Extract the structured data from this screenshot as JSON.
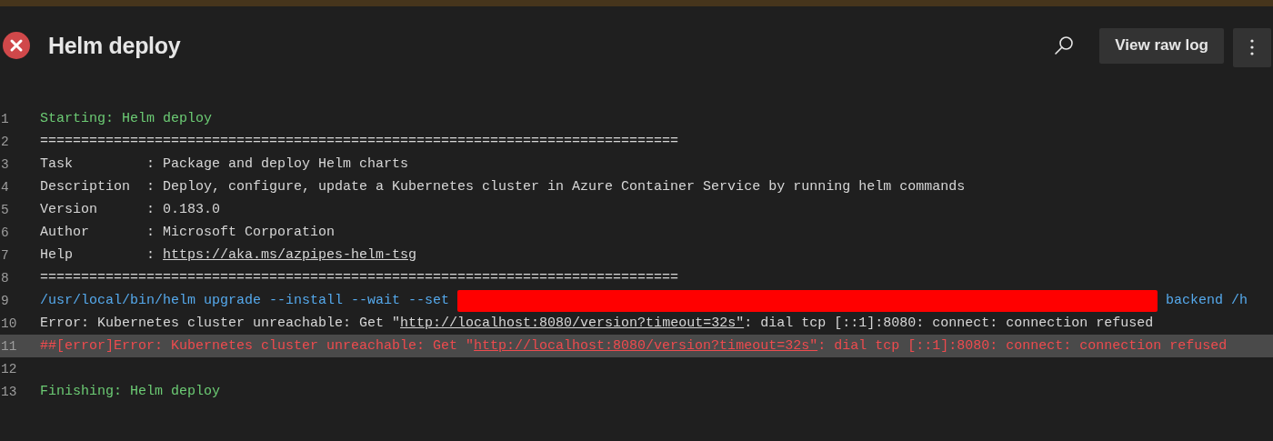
{
  "header": {
    "failed": true,
    "title": "Helm deploy",
    "actions": [
      {
        "kind": "search"
      },
      {
        "kind": "button",
        "label": "View raw log"
      },
      {
        "kind": "more"
      }
    ]
  },
  "log": [
    {
      "number": "1",
      "kind": "section",
      "selected": false,
      "segments": [
        {
          "text": "Starting: Helm deploy"
        }
      ]
    },
    {
      "number": "2",
      "kind": "plain",
      "selected": false,
      "segments": [
        {
          "text": "=============================================================================="
        }
      ]
    },
    {
      "number": "3",
      "kind": "plain",
      "selected": false,
      "segments": [
        {
          "text": "Task         : Package and deploy Helm charts"
        }
      ]
    },
    {
      "number": "4",
      "kind": "plain",
      "selected": false,
      "segments": [
        {
          "text": "Description  : Deploy, configure, update a Kubernetes cluster in Azure Container Service by running helm commands"
        }
      ]
    },
    {
      "number": "5",
      "kind": "plain",
      "selected": false,
      "segments": [
        {
          "text": "Version      : 0.183.0"
        }
      ]
    },
    {
      "number": "6",
      "kind": "plain",
      "selected": false,
      "segments": [
        {
          "text": "Author       : Microsoft Corporation"
        }
      ]
    },
    {
      "number": "7",
      "kind": "plain",
      "selected": false,
      "segments": [
        {
          "text": "Help         : "
        },
        {
          "text": "https://aka.ms/azpipes-helm-tsg",
          "kind": "link"
        }
      ]
    },
    {
      "number": "8",
      "kind": "plain",
      "selected": false,
      "segments": [
        {
          "text": "=============================================================================="
        }
      ]
    },
    {
      "number": "9",
      "kind": "command",
      "selected": false,
      "segments": [
        {
          "text": "/usr/local/bin/helm upgrade --install --wait --set "
        },
        {
          "kind": "redaction"
        },
        {
          "text": " backend /h"
        }
      ]
    },
    {
      "number": "10",
      "kind": "plain",
      "selected": false,
      "segments": [
        {
          "text": "Error: Kubernetes cluster unreachable: Get \""
        },
        {
          "text": "http://localhost:8080/version?timeout=32s\"",
          "kind": "link"
        },
        {
          "text": ": dial tcp [::1]:8080: connect: connection refused"
        }
      ]
    },
    {
      "number": "11",
      "kind": "error",
      "selected": true,
      "segments": [
        {
          "text": "##[error]Error: Kubernetes cluster unreachable: Get \""
        },
        {
          "text": "http://localhost:8080/version?timeout=32s\"",
          "kind": "link"
        },
        {
          "text": ": dial tcp [::1]:8080: connect: connection refused"
        }
      ]
    },
    {
      "number": "12",
      "kind": "plain",
      "selected": false
    },
    {
      "number": "13",
      "kind": "section",
      "selected": false,
      "segments": [
        {
          "text": "Finishing: Helm deploy"
        }
      ]
    }
  ]
}
